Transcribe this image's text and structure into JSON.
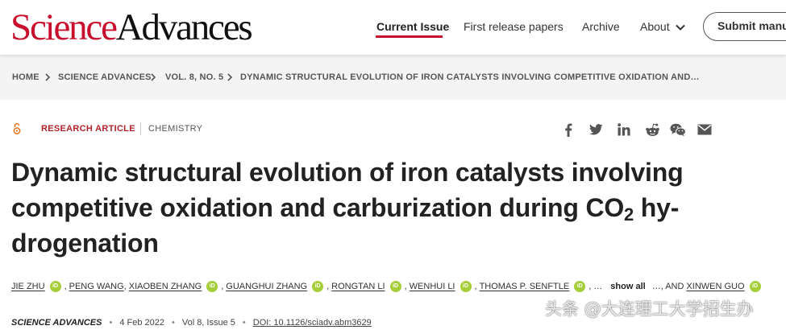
{
  "header": {
    "logo_part1": "Science",
    "logo_part2": "Advances",
    "nav": [
      {
        "label": "Current Issue",
        "active": true
      },
      {
        "label": "First release papers",
        "active": false
      },
      {
        "label": "Archive",
        "active": false
      },
      {
        "label": "About",
        "active": false,
        "has_dropdown": true
      }
    ],
    "submit_label": "Submit manus"
  },
  "breadcrumb": [
    "HOME",
    "SCIENCE ADVANCES",
    "VOL. 8, NO. 5",
    "DYNAMIC STRUCTURAL EVOLUTION OF IRON CATALYSTS INVOLVING COMPETITIVE OXIDATION AND…"
  ],
  "article": {
    "access_icon": "open-access-icon",
    "type": "RESEARCH ARTICLE",
    "subject": "CHEMISTRY",
    "share_icons": [
      "facebook-icon",
      "twitter-icon",
      "linkedin-icon",
      "reddit-icon",
      "wechat-icon",
      "email-icon"
    ],
    "title_line1": "Dynamic structural evolution of iron catalysts involving",
    "title_line2_pre": "competitive oxidation and carburization during CO",
    "title_sub": "2",
    "title_line2_post": " hy-",
    "title_line3": "drogenation",
    "authors": {
      "a1": "JIE ZHU",
      "a2": "PENG WANG",
      "a3": "XIAOBEN ZHANG",
      "a4": "GUANGHUI ZHANG",
      "a5": "RONGTAN LI",
      "a6": "WENHUI LI",
      "a7": "THOMAS P. SENFTLE",
      "ellipsis": "…",
      "show_all": "show all",
      "ellipsis2": "…",
      "last_prefix": ", AND",
      "last": "XINWEN GUO",
      "orcid": "iD"
    },
    "citation": {
      "journal": "SCIENCE ADVANCES",
      "date": "4 Feb 2022",
      "volume": "Vol 8, Issue 5",
      "doi": "DOI: 10.1126/sciadv.abm3629"
    }
  },
  "watermark": "头条 @大连理工大学招生办",
  "colors": {
    "brand_red": "#c8102e",
    "orcid_green": "#a6ce39",
    "breadcrumb_bg": "#f4f4f4"
  }
}
